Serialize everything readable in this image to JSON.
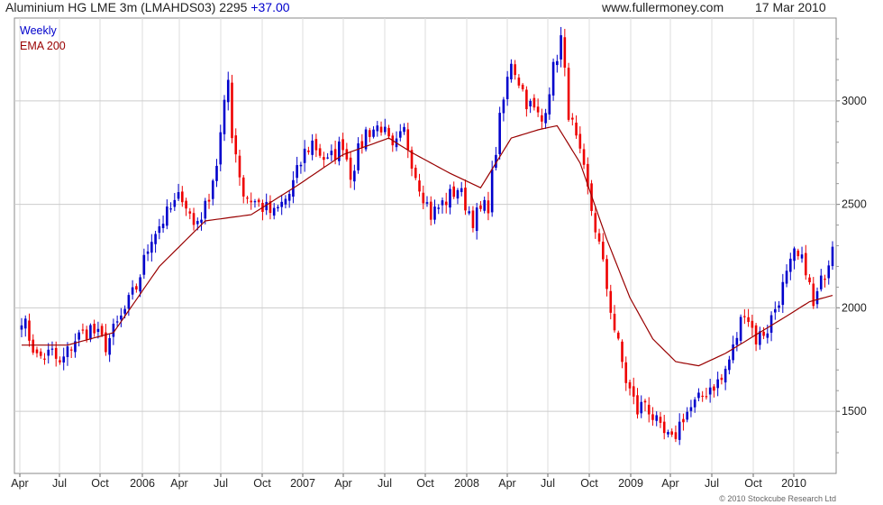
{
  "header": {
    "instrument": "Aluminium HG LME 3m (LMAHDS03)",
    "price": "2295",
    "change": "+37.00",
    "site": "www.fullermoney.com",
    "date": "17 Mar 2010"
  },
  "legend": {
    "weekly": "Weekly",
    "ema": "EMA 200"
  },
  "copyright": "© 2010 Stockcube Research Ltd",
  "colors": {
    "up": "#0000cc",
    "down": "#ee0000",
    "ema": "#990000",
    "grid": "#dddddd"
  },
  "chart_data": {
    "type": "candlestick",
    "ylim": [
      1200,
      3400
    ],
    "y_ticks": [
      1500,
      2000,
      2500,
      3000
    ],
    "x_ticks": [
      "Apr",
      "Jul",
      "Oct",
      "2006",
      "Apr",
      "Jul",
      "Oct",
      "2007",
      "Apr",
      "Jul",
      "Oct",
      "2008",
      "Apr",
      "Jul",
      "Oct",
      "2009",
      "Apr",
      "Jul",
      "Oct",
      "2010"
    ],
    "anchor_closes": [
      [
        0,
        1960
      ],
      [
        4,
        1760
      ],
      [
        8,
        1780
      ],
      [
        10,
        1720
      ],
      [
        14,
        1850
      ],
      [
        18,
        1900
      ],
      [
        22,
        1820
      ],
      [
        26,
        1950
      ],
      [
        30,
        2100
      ],
      [
        34,
        2350
      ],
      [
        38,
        2450
      ],
      [
        42,
        2550
      ],
      [
        45,
        2400
      ],
      [
        48,
        2480
      ],
      [
        51,
        2700
      ],
      [
        54,
        3100
      ],
      [
        55,
        2850
      ],
      [
        58,
        2550
      ],
      [
        62,
        2500
      ],
      [
        66,
        2450
      ],
      [
        70,
        2550
      ],
      [
        74,
        2750
      ],
      [
        76,
        2800
      ],
      [
        80,
        2700
      ],
      [
        84,
        2800
      ],
      [
        86,
        2650
      ],
      [
        90,
        2850
      ],
      [
        94,
        2880
      ],
      [
        97,
        2750
      ],
      [
        100,
        2850
      ],
      [
        103,
        2650
      ],
      [
        107,
        2450
      ],
      [
        111,
        2520
      ],
      [
        114,
        2580
      ],
      [
        118,
        2430
      ],
      [
        122,
        2500
      ],
      [
        125,
        2900
      ],
      [
        128,
        3200
      ],
      [
        132,
        3000
      ],
      [
        136,
        2900
      ],
      [
        139,
        3150
      ],
      [
        141,
        3300
      ],
      [
        143,
        2950
      ],
      [
        147,
        2650
      ],
      [
        151,
        2300
      ],
      [
        155,
        1900
      ],
      [
        158,
        1650
      ],
      [
        161,
        1500
      ],
      [
        163,
        1550
      ],
      [
        167,
        1400
      ],
      [
        170,
        1350
      ],
      [
        173,
        1480
      ],
      [
        177,
        1550
      ],
      [
        180,
        1620
      ],
      [
        183,
        1650
      ],
      [
        186,
        1800
      ],
      [
        189,
        2000
      ],
      [
        192,
        1850
      ],
      [
        195,
        1900
      ],
      [
        199,
        2100
      ],
      [
        202,
        2250
      ],
      [
        205,
        2200
      ],
      [
        207,
        2000
      ],
      [
        210,
        2180
      ],
      [
        212,
        2295
      ]
    ],
    "ema_200": [
      [
        0,
        1820
      ],
      [
        12,
        1820
      ],
      [
        24,
        1880
      ],
      [
        36,
        2200
      ],
      [
        48,
        2420
      ],
      [
        60,
        2450
      ],
      [
        72,
        2590
      ],
      [
        84,
        2740
      ],
      [
        96,
        2820
      ],
      [
        102,
        2750
      ],
      [
        112,
        2650
      ],
      [
        120,
        2580
      ],
      [
        128,
        2820
      ],
      [
        135,
        2860
      ],
      [
        140,
        2880
      ],
      [
        146,
        2700
      ],
      [
        153,
        2330
      ],
      [
        159,
        2050
      ],
      [
        165,
        1850
      ],
      [
        171,
        1740
      ],
      [
        177,
        1720
      ],
      [
        184,
        1780
      ],
      [
        192,
        1870
      ],
      [
        200,
        1960
      ],
      [
        206,
        2030
      ],
      [
        212,
        2060
      ]
    ],
    "series": [
      {
        "name": "Weekly",
        "type": "candlestick"
      },
      {
        "name": "EMA 200",
        "type": "line"
      }
    ]
  }
}
